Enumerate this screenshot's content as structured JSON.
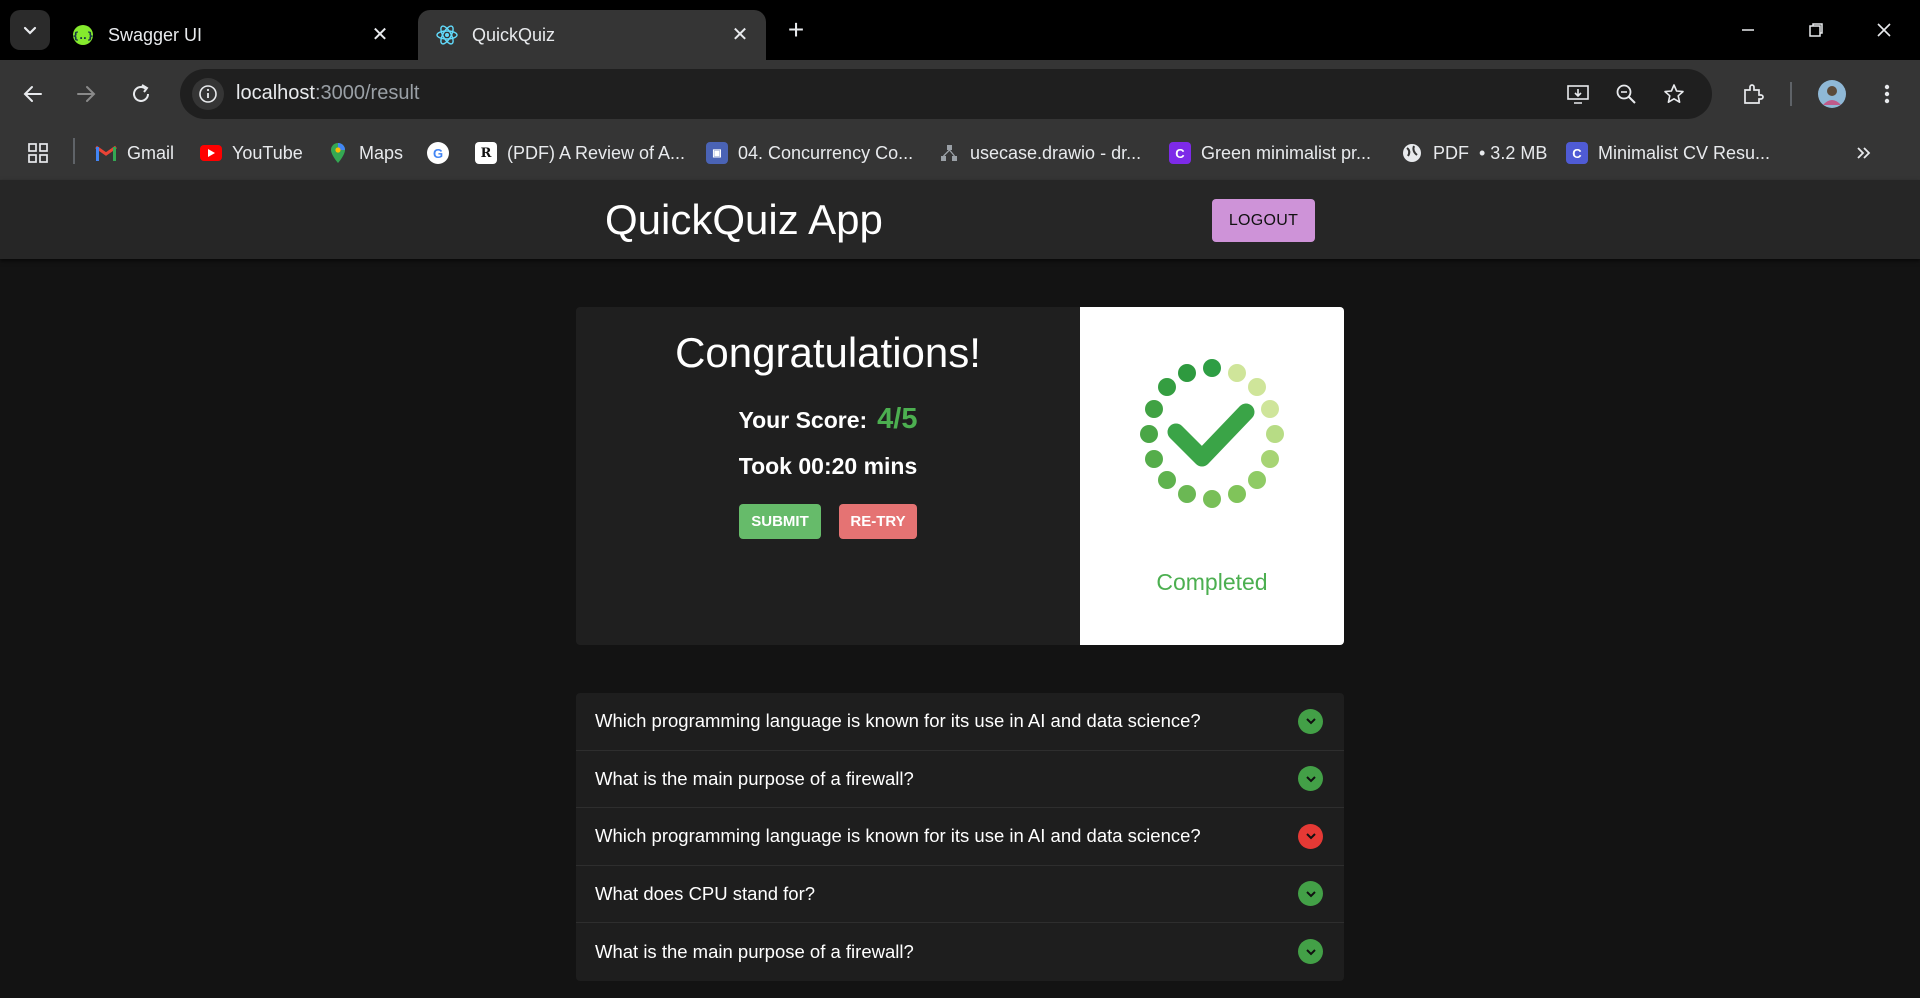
{
  "browser": {
    "tabs": [
      {
        "title": "Swagger UI",
        "icon": "swagger-icon",
        "active": false
      },
      {
        "title": "QuickQuiz",
        "icon": "react-icon",
        "active": true
      }
    ],
    "url_host": "localhost",
    "url_path": ":3000/result",
    "bookmarks": [
      {
        "label": "Gmail",
        "icon": "gmail-icon"
      },
      {
        "label": "YouTube",
        "icon": "youtube-icon"
      },
      {
        "label": "Maps",
        "icon": "maps-icon"
      },
      {
        "label": "",
        "icon": "google-icon"
      },
      {
        "label": "(PDF) A Review of A...",
        "icon": "researchgate-icon"
      },
      {
        "label": "04. Concurrency Co...",
        "icon": "doc-icon"
      },
      {
        "label": "usecase.drawio - dr...",
        "icon": "drawio-icon"
      },
      {
        "label": "Green minimalist pr...",
        "icon": "canva-icon"
      },
      {
        "label": "PDF",
        "icon": "globe-icon",
        "extra": "• 3.2 MB"
      },
      {
        "label": "Minimalist CV Resu...",
        "icon": "canva-icon"
      }
    ]
  },
  "app": {
    "title": "QuickQuiz App",
    "logout_label": "LOGOUT"
  },
  "result": {
    "heading": "Congratulations!",
    "score_label": "Your Score:",
    "score_value": "4/5",
    "took": "Took 00:20 mins",
    "submit_label": "SUBMIT",
    "retry_label": "RE-TRY",
    "status_label": "Completed"
  },
  "questions": [
    {
      "text": "Which programming language is known for its use in AI and data science?",
      "correct": true
    },
    {
      "text": "What is the main purpose of a firewall?",
      "correct": true
    },
    {
      "text": "Which programming language is known for its use in AI and data science?",
      "correct": false
    },
    {
      "text": "What does CPU stand for?",
      "correct": true
    },
    {
      "text": "What is the main purpose of a firewall?",
      "correct": true
    }
  ],
  "colors": {
    "correct": "#43a047",
    "incorrect": "#e53935",
    "accent_green": "#4caf50",
    "logout_bg": "#ce93d8"
  }
}
